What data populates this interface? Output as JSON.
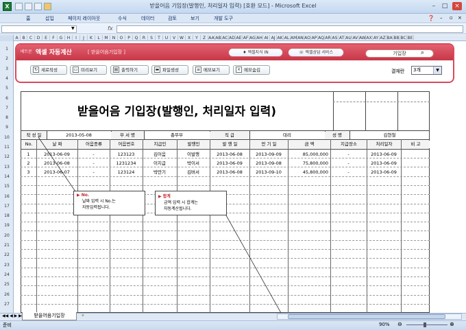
{
  "window": {
    "title": "받을어음 기입장(발행인, 처리일자 입력) [호환 모드] - Microsoft Excel"
  },
  "menu": [
    "홈",
    "삽입",
    "페이지 레이아웃",
    "수식",
    "데이터",
    "검토",
    "보기",
    "개발 도구"
  ],
  "formula_bar": {
    "fx": "fx"
  },
  "columns": [
    "A",
    "B",
    "C",
    "D",
    "E",
    "F",
    "G",
    "H",
    "I",
    "J",
    "K",
    "L",
    "M",
    "N",
    "O",
    "P",
    "Q",
    "R",
    "S",
    "T",
    "U",
    "V",
    "W",
    "X",
    "Y",
    "Z",
    "AA",
    "AB",
    "AC",
    "AD",
    "AE",
    "AF",
    "AG",
    "AH",
    "AI",
    "AJ",
    "AK",
    "AL",
    "AM",
    "AN",
    "AO",
    "AP",
    "AQ",
    "AR",
    "AS",
    "AT",
    "AU",
    "AV",
    "AW",
    "AX",
    "AY",
    "AZ",
    "BA",
    "BB",
    "BC",
    "BE"
  ],
  "rows": [
    "1",
    "2",
    "3",
    "4",
    "5",
    "6",
    "7",
    "8",
    "9",
    "10",
    "11",
    "12",
    "13",
    "14",
    "15",
    "16",
    "17",
    "18",
    "19",
    "20",
    "21",
    "22",
    "23",
    "24",
    "25",
    "26",
    "27"
  ],
  "banner": {
    "brand_small": "베트쿤",
    "brand": "엑셀 자동계산",
    "subtitle": "[ 받을어음기입장 ]",
    "link1": "엑셀지식 IN",
    "link2": "엑셀상담 서비스",
    "search": "기입장"
  },
  "toolbar": {
    "new": "새로작성",
    "preview": "미리보기",
    "print": "출력하기",
    "file": "파일생성",
    "memo_show": "메모보기",
    "memo_hide": "메모숨김",
    "approval_label": "결재란",
    "approval_value": "3개"
  },
  "form": {
    "title": "받을어음 기입장(발행인, 처리일자 입력)",
    "info": {
      "date_label": "작 성 일",
      "date": "2013-05-08",
      "dept_label": "부 서 명",
      "dept": "총무부",
      "rank_label": "직 급",
      "rank": "대리",
      "name_label": "성 명",
      "name": "김현철"
    },
    "headers": [
      "No.",
      "날 짜",
      "어음종류",
      "어음번호",
      "지급인",
      "발행인",
      "발 행 일",
      "만 기 일",
      "금 액",
      "지급장소",
      "처리일자",
      "비 고"
    ],
    "rows": [
      [
        "1",
        "2013-06-09",
        "-",
        "123123",
        "김어음",
        "이발행",
        "2013-06-08",
        "2013-09-09",
        "85,000,000",
        "-",
        "2013-06-09",
        ""
      ],
      [
        "2",
        "2013-06-08",
        "-",
        "1231234",
        "이지급",
        "박이서",
        "2013-06-09",
        "2013-09-08",
        "75,800,000",
        "-",
        "2013-06-09",
        ""
      ],
      [
        "3",
        "2013-06-07",
        "-",
        "123124",
        "박만기",
        "김버서",
        "2013-06-08",
        "2013-09-10",
        "45,800,000",
        "-",
        "2013-06-09",
        ""
      ]
    ]
  },
  "callouts": {
    "no": {
      "title": "▶ No.",
      "line1": "날짜 입력 시 No.는",
      "line2": "자동입력됩니다."
    },
    "sum": {
      "title": "▶ 합계",
      "line1": "금액 입력 시 합계는",
      "line2": "자동계산됩니다."
    }
  },
  "sheet": {
    "tab": "받을어음기입장"
  },
  "status": {
    "ready": "준비",
    "zoom": "90%"
  }
}
